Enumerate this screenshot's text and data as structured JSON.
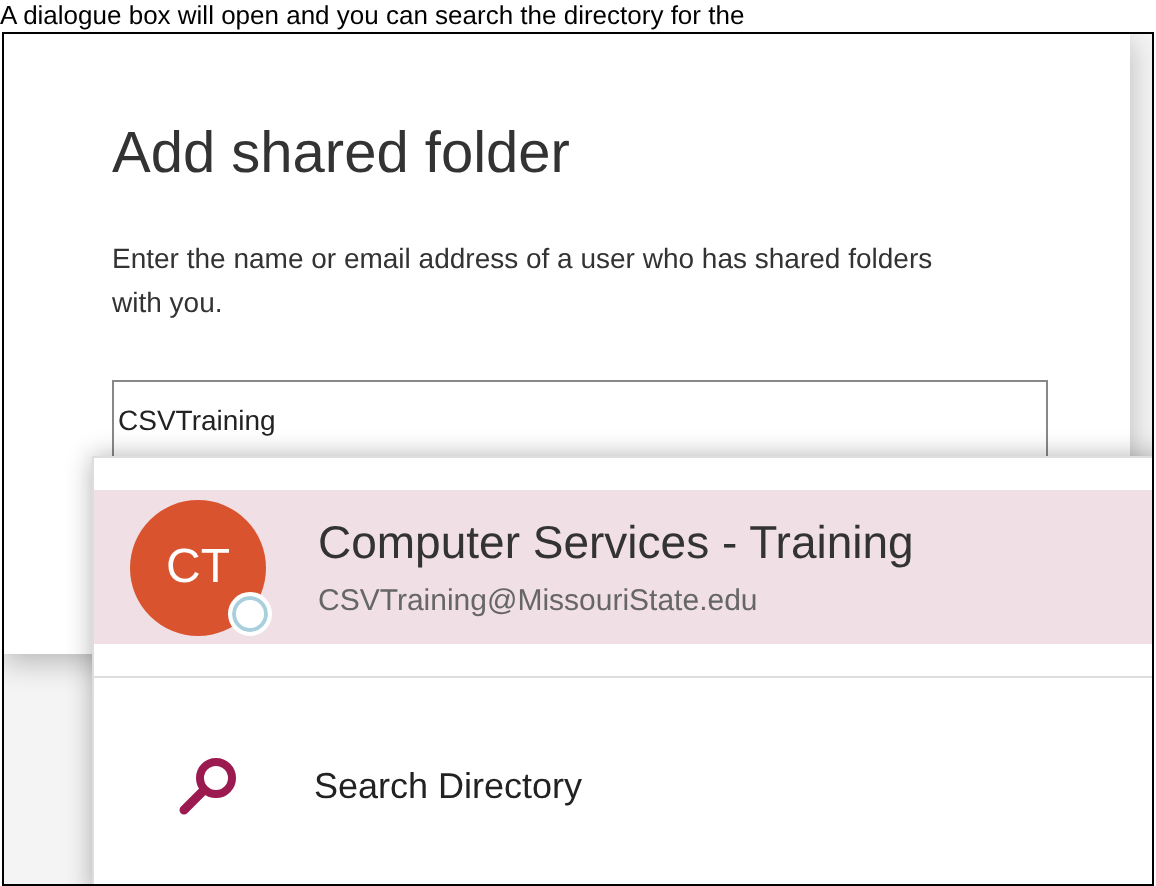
{
  "caption": "A dialogue box will open and you can search the directory for the",
  "dialog": {
    "title": "Add shared folder",
    "description": "Enter the name or email address of a user who has shared folders with you.",
    "input": {
      "value": "CSVTraining"
    }
  },
  "suggestions": [
    {
      "kind": "person",
      "initials": "CT",
      "name": "Computer Services - Training",
      "email": "CSVTraining@MissouriState.edu",
      "selected": true
    },
    {
      "kind": "search",
      "label": "Search Directory",
      "selected": false
    }
  ]
}
